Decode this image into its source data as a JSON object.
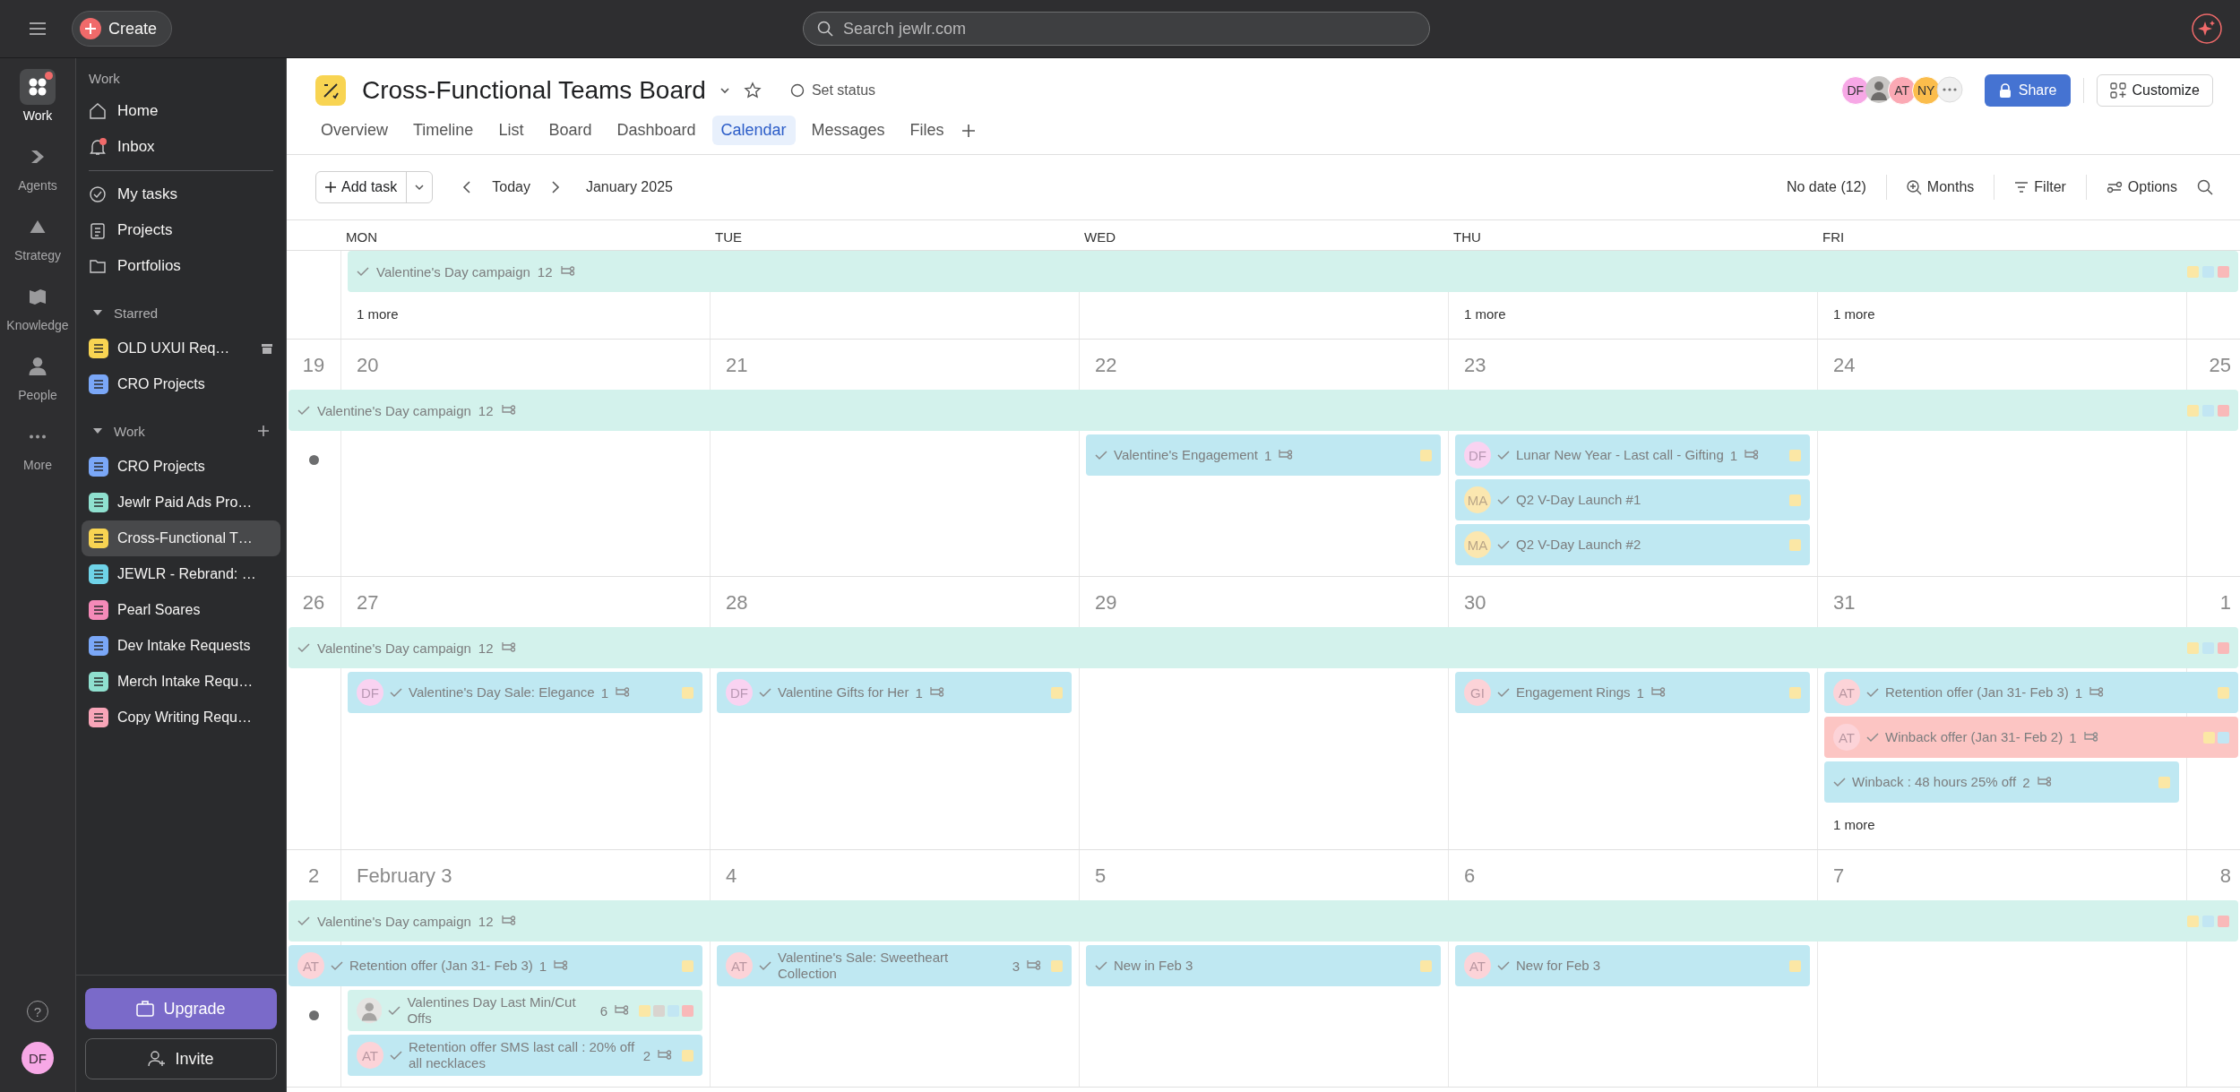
{
  "topbar": {
    "create_label": "Create",
    "search_placeholder": "Search jewlr.com"
  },
  "rail": {
    "items": [
      {
        "label": "Work",
        "selected": true,
        "notification": true
      },
      {
        "label": "Agents",
        "selected": false,
        "notification": false
      },
      {
        "label": "Strategy",
        "selected": false,
        "notification": false
      },
      {
        "label": "Knowledge",
        "selected": false,
        "notification": false
      },
      {
        "label": "People",
        "selected": false,
        "notification": false
      },
      {
        "label": "More",
        "selected": false,
        "notification": false
      }
    ],
    "help": "?",
    "user": {
      "initials": "DF",
      "color": "#f7a8e6"
    }
  },
  "sidebar": {
    "heading": "Work",
    "nav": [
      {
        "label": "Home",
        "notification": false
      },
      {
        "label": "Inbox",
        "notification": true
      }
    ],
    "nav2": [
      {
        "label": "My tasks"
      },
      {
        "label": "Projects"
      },
      {
        "label": "Portfolios"
      }
    ],
    "sections": [
      {
        "title": "Starred",
        "expanded": true,
        "items": [
          {
            "label": "OLD UXUI Req…",
            "color": "#f8d452",
            "selected": false,
            "archived": true
          },
          {
            "label": "CRO Projects",
            "color": "#7aa7f7",
            "selected": false,
            "archived": false
          }
        ]
      },
      {
        "title": "Work",
        "expanded": true,
        "can_add": true,
        "items": [
          {
            "label": "CRO Projects",
            "color": "#7aa7f7",
            "selected": false,
            "archived": false
          },
          {
            "label": "Jewlr Paid Ads Pro…",
            "color": "#8fe0cf",
            "selected": false,
            "archived": false
          },
          {
            "label": "Cross-Functional T…",
            "color": "#f8d452",
            "selected": true,
            "archived": false
          },
          {
            "label": "JEWLR - Rebrand: …",
            "color": "#6fd3e8",
            "selected": false,
            "archived": false
          },
          {
            "label": "Pearl Soares",
            "color": "#f58ab8",
            "selected": false,
            "archived": false
          },
          {
            "label": "Dev Intake Requests",
            "color": "#7aa7f7",
            "selected": false,
            "archived": false
          },
          {
            "label": "Merch Intake Requ…",
            "color": "#8fe0cf",
            "selected": false,
            "archived": false
          },
          {
            "label": "Copy Writing Requ…",
            "color": "#f8a5b8",
            "selected": false,
            "archived": false
          }
        ]
      }
    ],
    "upgrade": "Upgrade",
    "invite": "Invite"
  },
  "header": {
    "title": "Cross-Functional Teams Board",
    "status": "Set status",
    "tabs": [
      {
        "label": "Overview",
        "selected": false
      },
      {
        "label": "Timeline",
        "selected": false
      },
      {
        "label": "List",
        "selected": false
      },
      {
        "label": "Board",
        "selected": false
      },
      {
        "label": "Dashboard",
        "selected": false
      },
      {
        "label": "Calendar",
        "selected": true
      },
      {
        "label": "Messages",
        "selected": false
      },
      {
        "label": "Files",
        "selected": false
      }
    ],
    "members": [
      {
        "kind": "initials",
        "initials": "DF",
        "color": "#f7a8e6"
      },
      {
        "kind": "photo"
      },
      {
        "kind": "initials",
        "initials": "AT",
        "color": "#fba9b4"
      },
      {
        "kind": "initials",
        "initials": "NY",
        "color": "#fbbd4c"
      }
    ],
    "share": "Share",
    "customize": "Customize"
  },
  "toolbar": {
    "add_task": "Add task",
    "today": "Today",
    "period": "January 2025",
    "no_date": "No date (12)",
    "months": "Months",
    "filter": "Filter",
    "options": "Options"
  },
  "calendar": {
    "weekdays": [
      "MON",
      "TUE",
      "WED",
      "THU",
      "FRI"
    ],
    "weeks": [
      {
        "banner": {
          "title": "Valentine's Day campaign",
          "count": "12",
          "from_monday": true,
          "tags": [
            {
              "color": "#fbe7a5"
            },
            {
              "color": "#c2e6f3"
            },
            {
              "color": "#f9b9b9"
            }
          ]
        },
        "cells": [
          {},
          {
            "more": "1 more"
          },
          {},
          {},
          {
            "more": "1 more"
          },
          {
            "more": "1 more"
          },
          {}
        ]
      },
      {
        "banner": {
          "title": "Valentine's Day campaign",
          "count": "12",
          "from_monday": false,
          "tags": [
            {
              "color": "#fbe7a5"
            },
            {
              "color": "#c2e6f3"
            },
            {
              "color": "#f9b9b9"
            }
          ]
        },
        "cells": [
          {
            "date": "19",
            "dot": true
          },
          {
            "date": "20"
          },
          {
            "date": "21"
          },
          {
            "date": "22",
            "tasks": [
              {
                "title": "Valentine's Engagement",
                "count": "1",
                "continues_next_day": false,
                "color": "#bfe8f2",
                "tags": [
                  {
                    "color": "#fbe7a5"
                  }
                ]
              }
            ]
          },
          {
            "date": "23",
            "tasks": [
              {
                "title": "Lunar New Year - Last call - Gifting",
                "count": "1",
                "avatar": {
                  "kind": "initials",
                  "initials": "DF",
                  "color": "#f9d3f1"
                },
                "continues_next_day": false,
                "color": "#bfe8f2",
                "tags": [
                  {
                    "color": "#fbe7a5"
                  }
                ]
              },
              {
                "title": "Q2 V-Day Launch #1",
                "avatar": {
                  "kind": "initials",
                  "initials": "MA",
                  "color": "#fbe7b0"
                },
                "continues_next_day": false,
                "color": "#bfe8f2",
                "tags": [
                  {
                    "color": "#fbe7a5"
                  }
                ]
              },
              {
                "title": "Q2 V-Day Launch #2",
                "avatar": {
                  "kind": "initials",
                  "initials": "MA",
                  "color": "#fbe7b0"
                },
                "continues_next_day": false,
                "color": "#bfe8f2",
                "tags": [
                  {
                    "color": "#fbe7a5"
                  }
                ]
              }
            ]
          },
          {
            "date": "24"
          },
          {
            "date": "25"
          }
        ]
      },
      {
        "banner": {
          "title": "Valentine's Day campaign",
          "count": "12",
          "from_monday": false,
          "tags": [
            {
              "color": "#fbe7a5"
            },
            {
              "color": "#c2e6f3"
            },
            {
              "color": "#f9b9b9"
            }
          ]
        },
        "cells": [
          {
            "date": "26"
          },
          {
            "date": "27",
            "tasks": [
              {
                "title": "Valentine's Day Sale: Elegance",
                "count": "1",
                "avatar": {
                  "kind": "initials",
                  "initials": "DF",
                  "color": "#f9d3f1"
                },
                "continues_next_day": false,
                "color": "#bfe8f2",
                "tags": [
                  {
                    "color": "#fbe7a5"
                  }
                ]
              }
            ]
          },
          {
            "date": "28",
            "tasks": [
              {
                "title": "Valentine Gifts for Her",
                "count": "1",
                "avatar": {
                  "kind": "initials",
                  "initials": "DF",
                  "color": "#f9d3f1"
                },
                "continues_next_day": false,
                "color": "#bfe8f2",
                "tags": [
                  {
                    "color": "#fbe7a5"
                  }
                ]
              }
            ]
          },
          {
            "date": "29"
          },
          {
            "date": "30",
            "tasks": [
              {
                "title": "Engagement Rings",
                "count": "1",
                "avatar": {
                  "kind": "initials",
                  "initials": "GI",
                  "color": "#fcd3d8"
                },
                "continues_next_day": false,
                "color": "#bfe8f2",
                "tags": [
                  {
                    "color": "#fbe7a5"
                  }
                ]
              }
            ]
          },
          {
            "date": "31",
            "more": "1 more",
            "tasks": [
              {
                "title": "Retention offer (Jan 31- Feb 3)",
                "count": "1",
                "avatar": {
                  "kind": "initials",
                  "initials": "AT",
                  "color": "#fcd3d8"
                },
                "continues_next_day": true,
                "color": "#bfe8f2",
                "tags": [
                  {
                    "color": "#fbe7a5"
                  }
                ]
              },
              {
                "title": "Winback offer (Jan 31- Feb 2)",
                "count": "1",
                "avatar": {
                  "kind": "initials",
                  "initials": "AT",
                  "color": "#fcd3d8"
                },
                "continues_next_day": true,
                "color": "#fcc5c3",
                "tags": [
                  {
                    "color": "#fbe7a5"
                  },
                  {
                    "color": "#c2e6f3"
                  }
                ]
              },
              {
                "title": "Winback : 48 hours 25% off",
                "count": "2",
                "continues_next_day": false,
                "color": "#bfe8f2",
                "tags": [
                  {
                    "color": "#fbe7a5"
                  }
                ]
              }
            ]
          },
          {
            "date": "1"
          }
        ]
      },
      {
        "banner": {
          "title": "Valentine's Day campaign",
          "count": "12",
          "from_monday": false,
          "tags": [
            {
              "color": "#fbe7a5"
            },
            {
              "color": "#c2e6f3"
            },
            {
              "color": "#f9b9b9"
            }
          ]
        },
        "cells": [
          {
            "date": "2",
            "dot": true,
            "tasks": [
              {
                "title": "Retention offer (Jan 31- Feb 3)",
                "count": "1",
                "avatar": {
                  "kind": "initials",
                  "initials": "AT",
                  "color": "#fcd3d8"
                },
                "continues_next_day": true,
                "color": "#bfe8f2",
                "tags": [
                  {
                    "color": "#fbe7a5"
                  }
                ]
              }
            ]
          },
          {
            "date": "February 3",
            "tasks": [
              {
                "title": "Valentines Day Last Min/Cut Offs",
                "count": "6",
                "avatar": {
                  "kind": "photo"
                },
                "continues_next_day": false,
                "color": "#d3f2ec",
                "tags": [
                  {
                    "color": "#fbe7a5"
                  },
                  {
                    "color": "#d9d4cf"
                  },
                  {
                    "color": "#c2e6f3"
                  },
                  {
                    "color": "#f9b9b9"
                  }
                ]
              },
              {
                "title": "Retention offer SMS last call : 20% off all necklaces",
                "count": "2",
                "avatar": {
                  "kind": "initials",
                  "initials": "AT",
                  "color": "#fcd3d8"
                },
                "continues_next_day": false,
                "color": "#bfe8f2",
                "tags": [
                  {
                    "color": "#fbe7a5"
                  }
                ]
              }
            ]
          },
          {
            "date": "4",
            "tasks": [
              {
                "title": "Valentine's Sale: Sweetheart Collection",
                "count": "3",
                "avatar": {
                  "kind": "initials",
                  "initials": "AT",
                  "color": "#fcd3d8"
                },
                "continues_next_day": false,
                "color": "#bfe8f2",
                "tags": [
                  {
                    "color": "#fbe7a5"
                  }
                ]
              }
            ]
          },
          {
            "date": "5",
            "tasks": [
              {
                "title": "New in Feb 3",
                "continues_next_day": false,
                "color": "#bfe8f2",
                "tags": [
                  {
                    "color": "#fbe7a5"
                  }
                ]
              }
            ]
          },
          {
            "date": "6",
            "tasks": [
              {
                "title": "New for Feb 3",
                "avatar": {
                  "kind": "initials",
                  "initials": "AT",
                  "color": "#fcd3d8"
                },
                "continues_next_day": false,
                "color": "#bfe8f2",
                "tags": [
                  {
                    "color": "#fbe7a5"
                  }
                ]
              }
            ]
          },
          {
            "date": "7"
          },
          {
            "date": "8"
          }
        ]
      }
    ]
  }
}
